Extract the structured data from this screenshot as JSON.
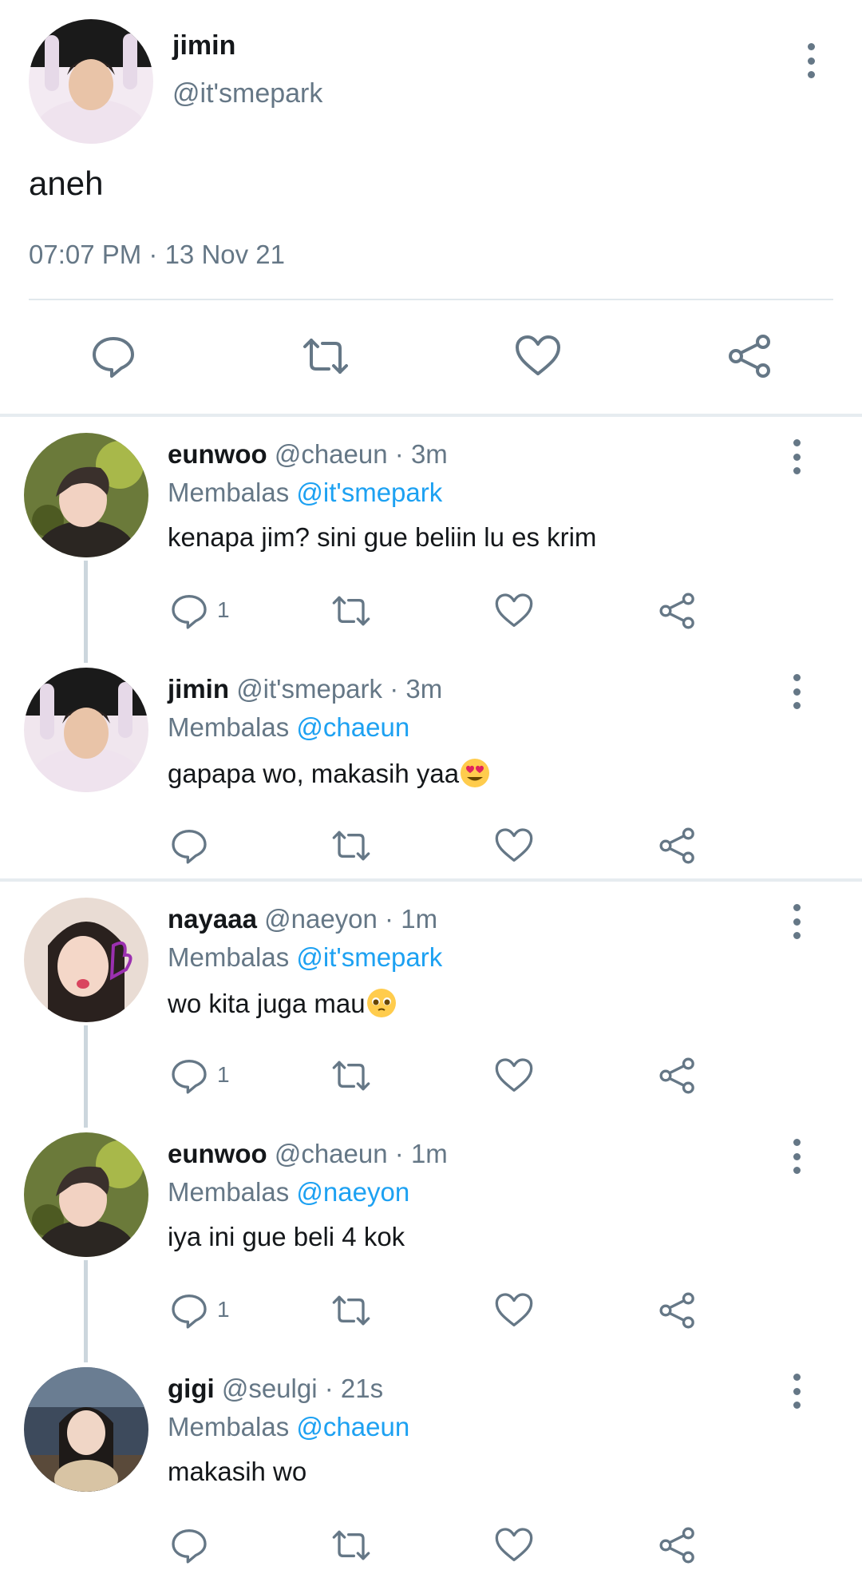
{
  "main_tweet": {
    "name": "jimin",
    "handle": "@it'smepark",
    "text": "aneh",
    "timestamp": "07:07 PM · 13 Nov 21",
    "actions": [
      "comment-icon",
      "retweet-icon",
      "heart-icon",
      "share-icon"
    ]
  },
  "replies": [
    {
      "name": "eunwoo",
      "handle": "@chaeun",
      "time": "3m",
      "reply_label": "Membalas",
      "reply_to": "@it'smepark",
      "text": "kenapa jim? sini gue beliin lu es krim",
      "reply_count": "1",
      "avatar_bg": "#6b7a3a"
    },
    {
      "name": "jimin",
      "handle": "@it'smepark",
      "time": "3m",
      "reply_label": "Membalas",
      "reply_to": "@chaeun",
      "text": "gapapa wo, makasih yaa",
      "reply_count": "",
      "avatar_bg": "#f0e6ee"
    },
    {
      "name": "nayaaa",
      "handle": "@naeyon",
      "time": "1m",
      "reply_label": "Membalas",
      "reply_to": "@it'smepark",
      "text": "wo kita juga mau",
      "reply_count": "1",
      "avatar_bg": "#e9dcd4"
    },
    {
      "name": "eunwoo",
      "handle": "@chaeun",
      "time": "1m",
      "reply_label": "Membalas",
      "reply_to": "@naeyon",
      "text": "iya ini gue beli 4 kok",
      "reply_count": "1",
      "avatar_bg": "#6b7a3a"
    },
    {
      "name": "gigi",
      "handle": "@seulgi",
      "time": "21s",
      "reply_label": "Membalas",
      "reply_to": "@chaeun",
      "text": "makasih wo",
      "reply_count": "",
      "avatar_bg": "#3d4a5c"
    }
  ],
  "colors": {
    "text_primary": "#14171a",
    "text_secondary": "#657786",
    "mention": "#1da1f2",
    "divider": "#e1e8ed",
    "thread_line": "#ccd6dd"
  }
}
